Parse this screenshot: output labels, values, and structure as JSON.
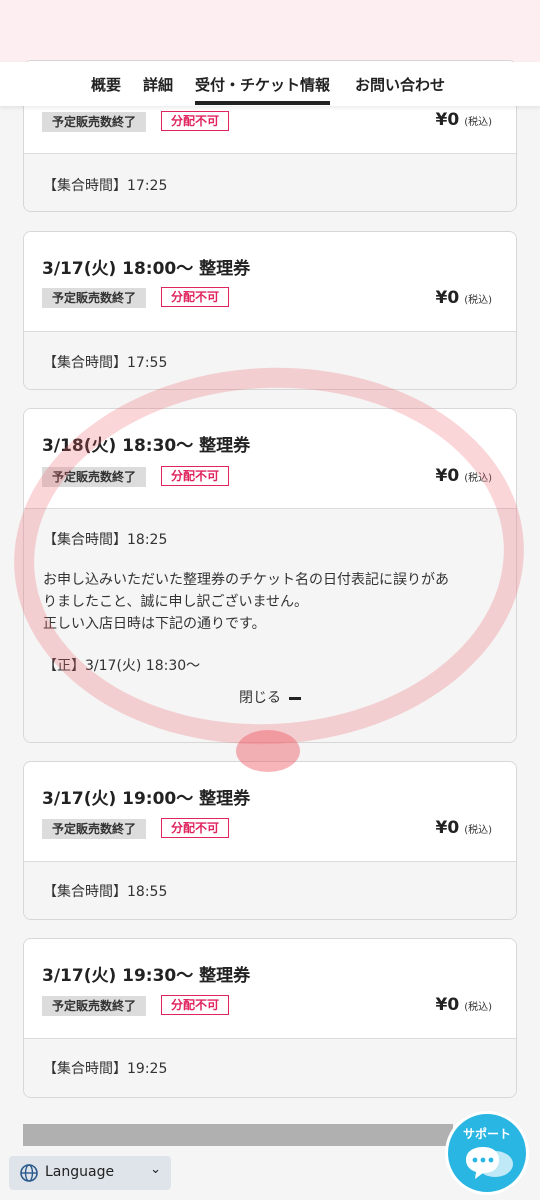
{
  "tabs": [
    {
      "label": "概要"
    },
    {
      "label": "詳細"
    },
    {
      "label": "受付・チケット情報"
    },
    {
      "label": "お問い合わせ"
    }
  ],
  "cards": [
    {
      "title": "",
      "status": "予定販売数終了",
      "badge": "分配不可",
      "price": "¥0",
      "tax": "(税込)",
      "meet": "【集合時間】17:25"
    },
    {
      "title": "3/17(火) 18:00〜 整理券",
      "status": "予定販売数終了",
      "badge": "分配不可",
      "price": "¥0",
      "tax": "(税込)",
      "meet": "【集合時間】17:55"
    },
    {
      "title": "3/18(火) 18:30〜 整理券",
      "status": "予定販売数終了",
      "badge": "分配不可",
      "price": "¥0",
      "tax": "(税込)",
      "meet": "【集合時間】18:25",
      "note_line1": "お申し込みいただいた整理券のチケット名の日付表記に誤りがあ",
      "note_line2": "りましたこと、誠に申し訳ございません。",
      "note_line3": "正しい入店日時は下記の通りです。",
      "correct": "【正】3/17(火) 18:30〜",
      "close": "閉じる"
    },
    {
      "title": "3/17(火) 19:00〜 整理券",
      "status": "予定販売数終了",
      "badge": "分配不可",
      "price": "¥0",
      "tax": "(税込)",
      "meet": "【集合時間】18:55"
    },
    {
      "title": "3/17(火) 19:30〜 整理券",
      "status": "予定販売数終了",
      "badge": "分配不可",
      "price": "¥0",
      "tax": "(税込)",
      "meet": "【集合時間】19:25"
    }
  ],
  "language": {
    "label": "Language",
    "icon": "globe-icon"
  },
  "support": {
    "label": "サポート",
    "icon": "chat-bubble-icon",
    "color": "#29b6e3"
  },
  "colors": {
    "accent_red": "#e0245e",
    "header_pink": "#fdeff1",
    "annotation_red": "#f05a64"
  }
}
